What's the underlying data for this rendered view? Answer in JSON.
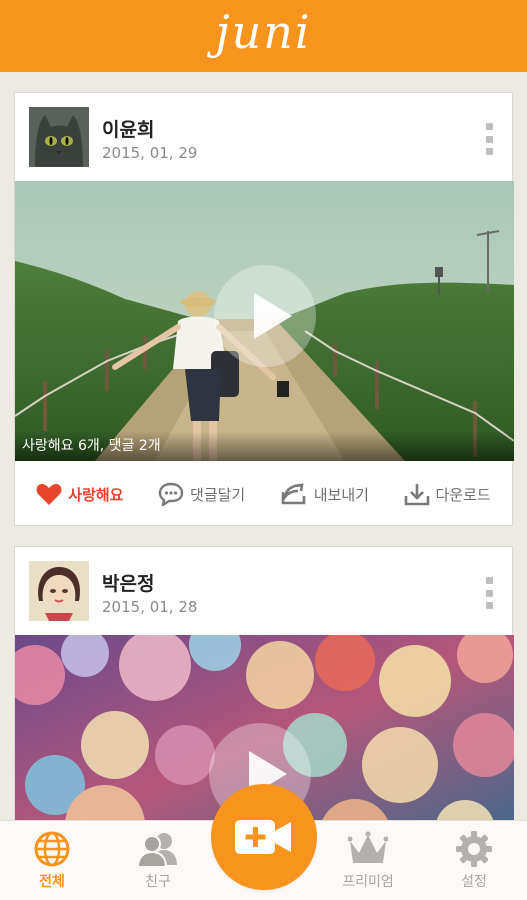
{
  "app": {
    "logo": "juni",
    "brand_color": "#f7941d"
  },
  "posts": [
    {
      "author": "이윤희",
      "date": "2015, 01, 29",
      "stats": "사랑해요 6개, 댓글 2개",
      "actions": {
        "love": "사랑해요",
        "comment": "댓글달기",
        "share": "내보내기",
        "download": "다운로드"
      }
    },
    {
      "author": "박은정",
      "date": "2015, 01, 28"
    }
  ],
  "tabs": [
    {
      "label": "전체",
      "icon": "globe-icon",
      "active": true
    },
    {
      "label": "친구",
      "icon": "friends-icon",
      "active": false
    },
    {
      "label": "",
      "icon": "video-camera-plus-icon",
      "active": false
    },
    {
      "label": "프리미엄",
      "icon": "crown-icon",
      "active": false
    },
    {
      "label": "설정",
      "icon": "gear-icon",
      "active": false
    }
  ],
  "colors": {
    "accent": "#f7941d",
    "love": "#e8442c",
    "muted": "#a9a6a2"
  }
}
